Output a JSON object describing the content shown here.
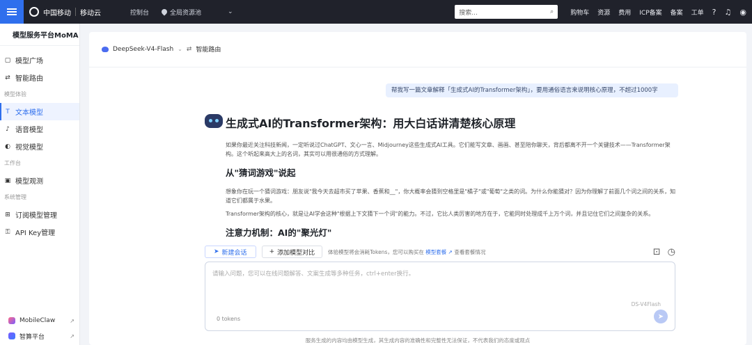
{
  "topbar": {
    "brand1": "中国移动",
    "brand2": "移动云",
    "console": "控制台",
    "region": "全局资源池",
    "search_placeholder": "搜索...",
    "links": [
      "购物车",
      "资源",
      "费用",
      "ICP备案",
      "备案",
      "工单"
    ]
  },
  "sidebar": {
    "title": "模型服务平台MoMA",
    "items": [
      {
        "label": "模型广场",
        "icon": "box-icon"
      },
      {
        "label": "智能路由",
        "icon": "route-icon"
      }
    ],
    "group1": "模型体验",
    "experience": [
      {
        "label": "文本模型",
        "icon": "text-icon",
        "active": true
      },
      {
        "label": "语音模型",
        "icon": "voice-icon"
      },
      {
        "label": "视觉模型",
        "icon": "vision-icon"
      }
    ],
    "group2": "工作台",
    "workbench": [
      {
        "label": "模型观测",
        "icon": "monitor-icon"
      }
    ],
    "group3": "系统管理",
    "system": [
      {
        "label": "订阅模型管理",
        "icon": "subscribe-icon"
      },
      {
        "label": "API Key管理",
        "icon": "key-icon"
      }
    ],
    "bottom": [
      {
        "label": "MobileClaw"
      },
      {
        "label": "智算平台"
      }
    ]
  },
  "main": {
    "model_name": "DeepSeek-V4-Flash",
    "route_label": "智能路由",
    "user_message": "帮我写一篇文章解释「生成式AI的Transformer架构」，要用通俗语言来说明核心原理，不超过1000字",
    "answer": {
      "title": "生成式AI的Transformer架构：用大白话讲清楚核心原理",
      "intro": "如果你最近关注科技新闻，一定听说过ChatGPT、文心一言、Midjourney这些生成式AI工具。它们能写文章、画画、甚至陪你聊天，背后都离不开一个关键技术——Transformer架构。这个听起来高大上的名词，其实可以用很通俗的方式理解。",
      "h2_1": "从\"猜词游戏\"说起",
      "p1": "想象你在玩一个猜词游戏：朋友说\"我今天去超市买了苹果、香蕉和__\"，你大概率会猜到空格里是\"橘子\"或\"葡萄\"之类的词。为什么你能猜对？因为你理解了前面几个词之间的关系，知道它们都属于水果。",
      "p2": "Transformer架构的核心，就是让AI学会这种\"根据上下文猜下一个词\"的能力。不过，它比人类厉害的地方在于，它能同时处理成千上万个词，并且记住它们之间复杂的关系。",
      "h2_2": "注意力机制：AI的\"聚光灯\""
    },
    "toolbar": {
      "new_chat": "新建会话",
      "add_model": "添加模型对比",
      "note": "体验模型将会消耗Tokens，您可以购买在",
      "note_link": "模型套餐",
      "note_tail": "查看套餐情况"
    },
    "input": {
      "placeholder": "请输入问题，您可以在线问题解答、文案生成等多种任务，ctrl+enter换行。",
      "model_tag": "DS-V4Flash",
      "tokens": "0 tokens"
    },
    "footer": "服务生成的内容均由模型生成，其生成内容的准确性和完整性无法保证，不代表我们的态度或观点"
  }
}
